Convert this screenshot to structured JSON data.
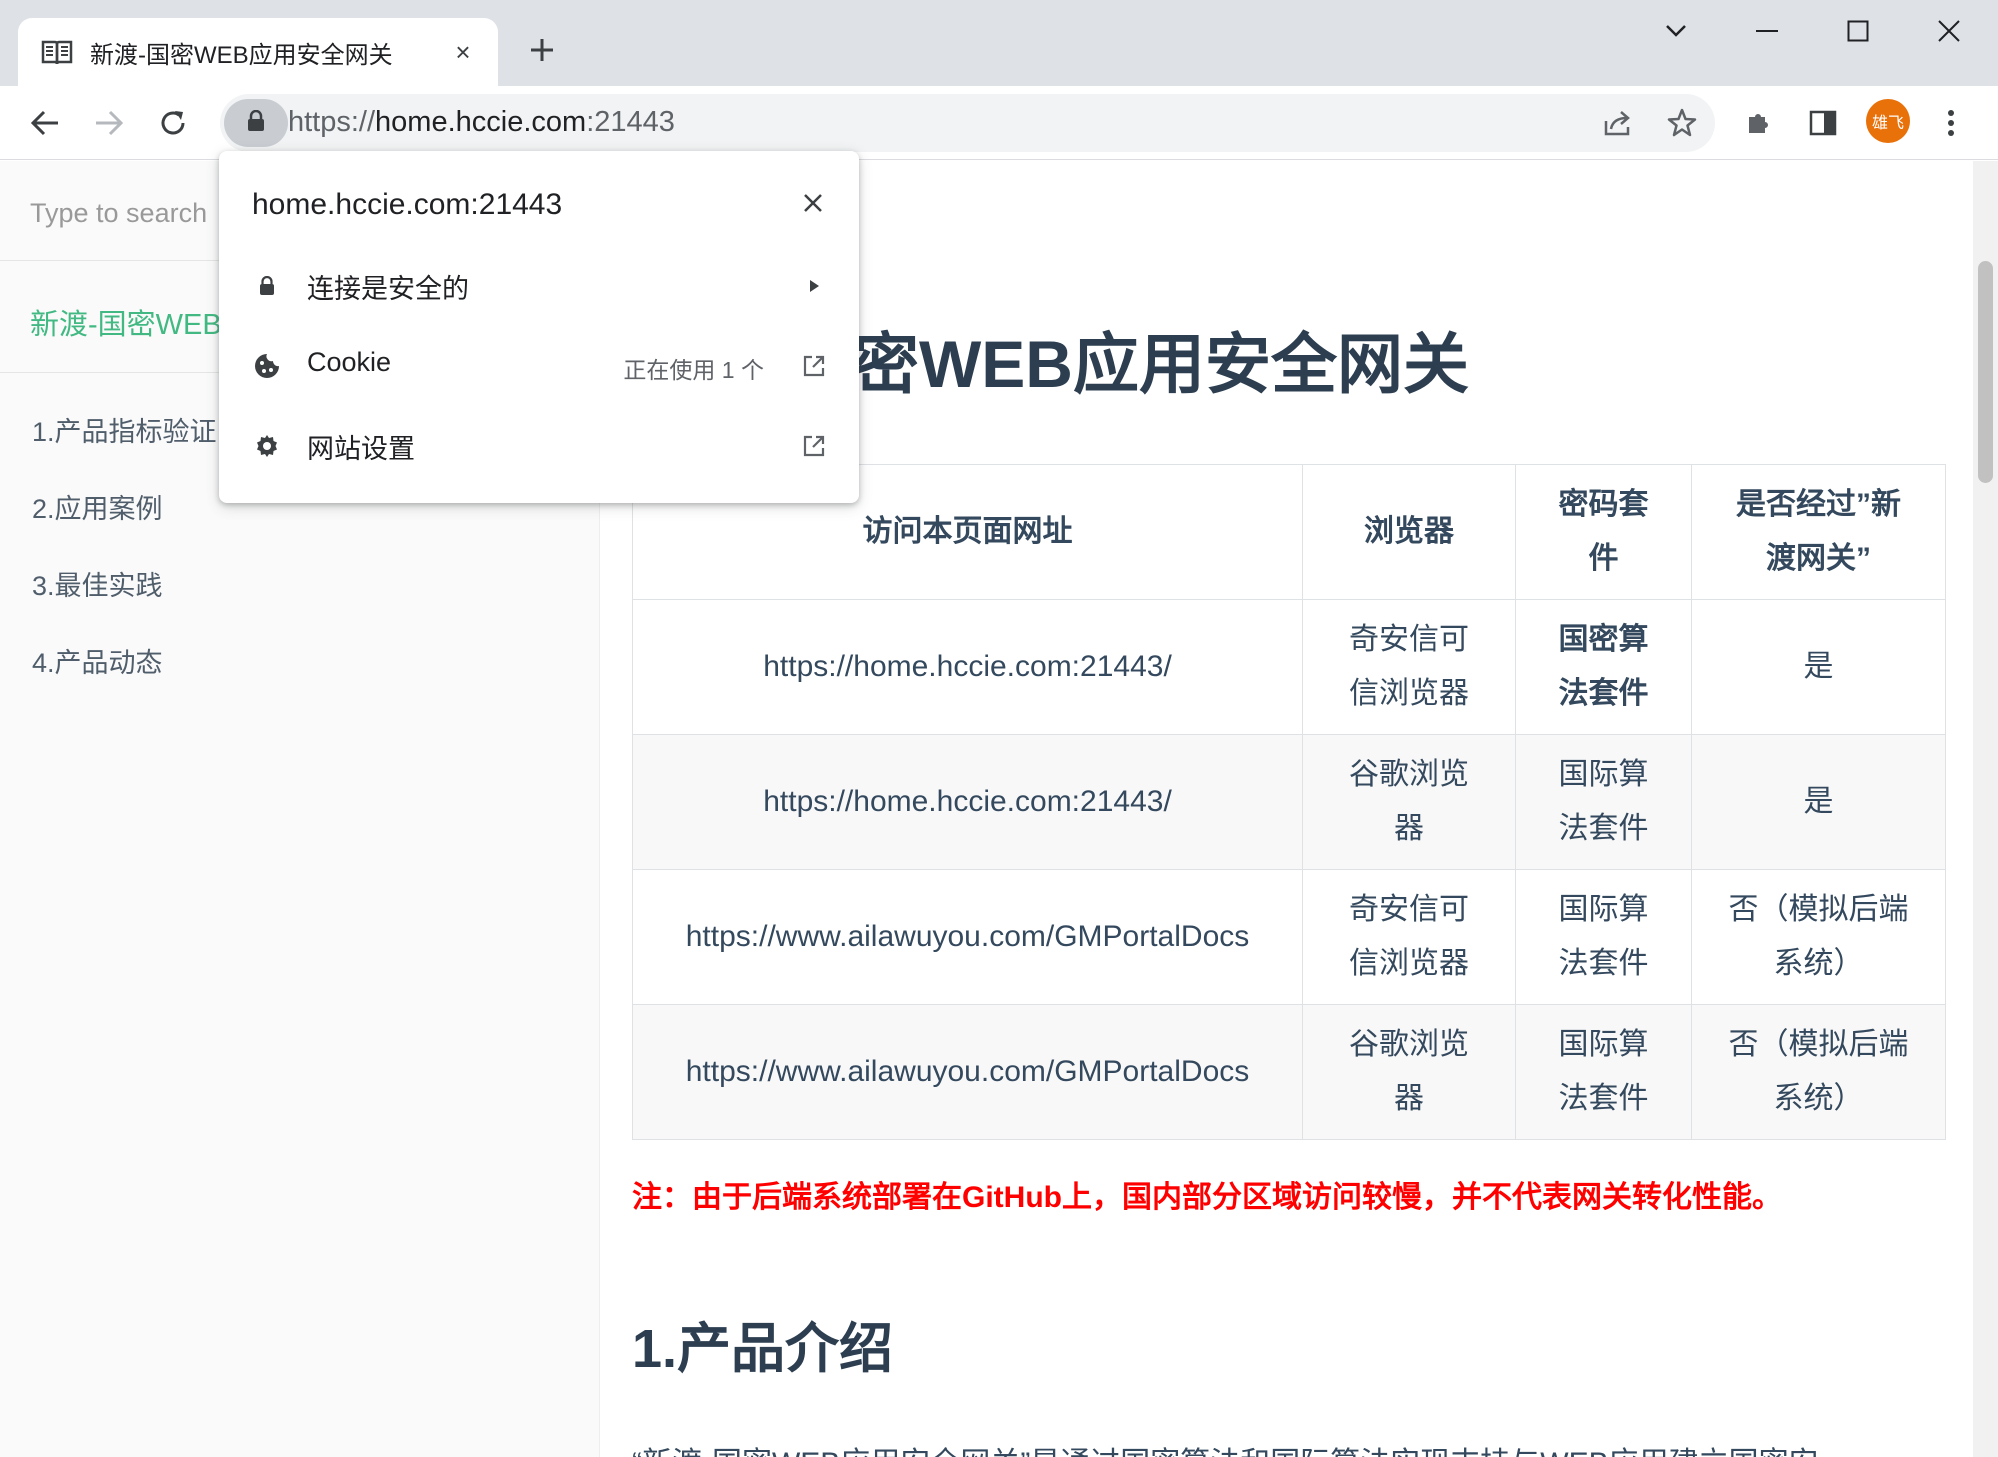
{
  "browser": {
    "tab_title": "新渡-国密WEB应用安全网关",
    "tab_close": "×",
    "url_protocol": "https://",
    "url_host": "home.hccie.com",
    "url_port": ":21443",
    "avatar_label": "雄飞",
    "accent_color": "#e8710a"
  },
  "site_info_popup": {
    "host": "home.hccie.com:21443",
    "rows": [
      {
        "icon": "lock-icon",
        "label": "连接是安全的",
        "sub": "",
        "action": "chevron-right-icon"
      },
      {
        "icon": "cookie-icon",
        "label": "Cookie",
        "sub": "正在使用 1 个",
        "action": "external-link-icon"
      },
      {
        "icon": "gear-icon",
        "label": "网站设置",
        "sub": "",
        "action": "external-link-icon"
      }
    ]
  },
  "sidebar": {
    "search_placeholder": "Type to search",
    "title": "新渡-国密WEB应用安全网关",
    "items": [
      "1.产品指标验证",
      "2.应用案例",
      "3.最佳实践",
      "4.产品动态"
    ]
  },
  "main": {
    "title": "新渡-国密WEB应用安全网关",
    "table": {
      "headers": [
        "访问本页面网址",
        "浏览器",
        "密码套\n件",
        "是否经过”新\n渡网关”"
      ],
      "rows": [
        [
          "https://home.hccie.com:21443/",
          "奇安信可\n信浏览器",
          "国密算\n法套件",
          "是"
        ],
        [
          "https://home.hccie.com:21443/",
          "谷歌浏览\n器",
          "国际算\n法套件",
          "是"
        ],
        [
          "https://www.ailawuyou.com/GMPortalDocs",
          "奇安信可\n信浏览器",
          "国际算\n法套件",
          "否（模拟后端\n系统）"
        ],
        [
          "https://www.ailawuyou.com/GMPortalDocs",
          "谷歌浏览\n器",
          "国际算\n法套件",
          "否（模拟后端\n系统）"
        ]
      ]
    },
    "note": "注：由于后端系统部署在GitHub上，国内部分区域访问较慢，并不代表网关转化性能。",
    "section_title": "1.产品介绍",
    "paragraph": "“新渡-国密WEB应用安全网关”是通过国密算法和国际算法实现支持与WEB应用建立国密安"
  }
}
